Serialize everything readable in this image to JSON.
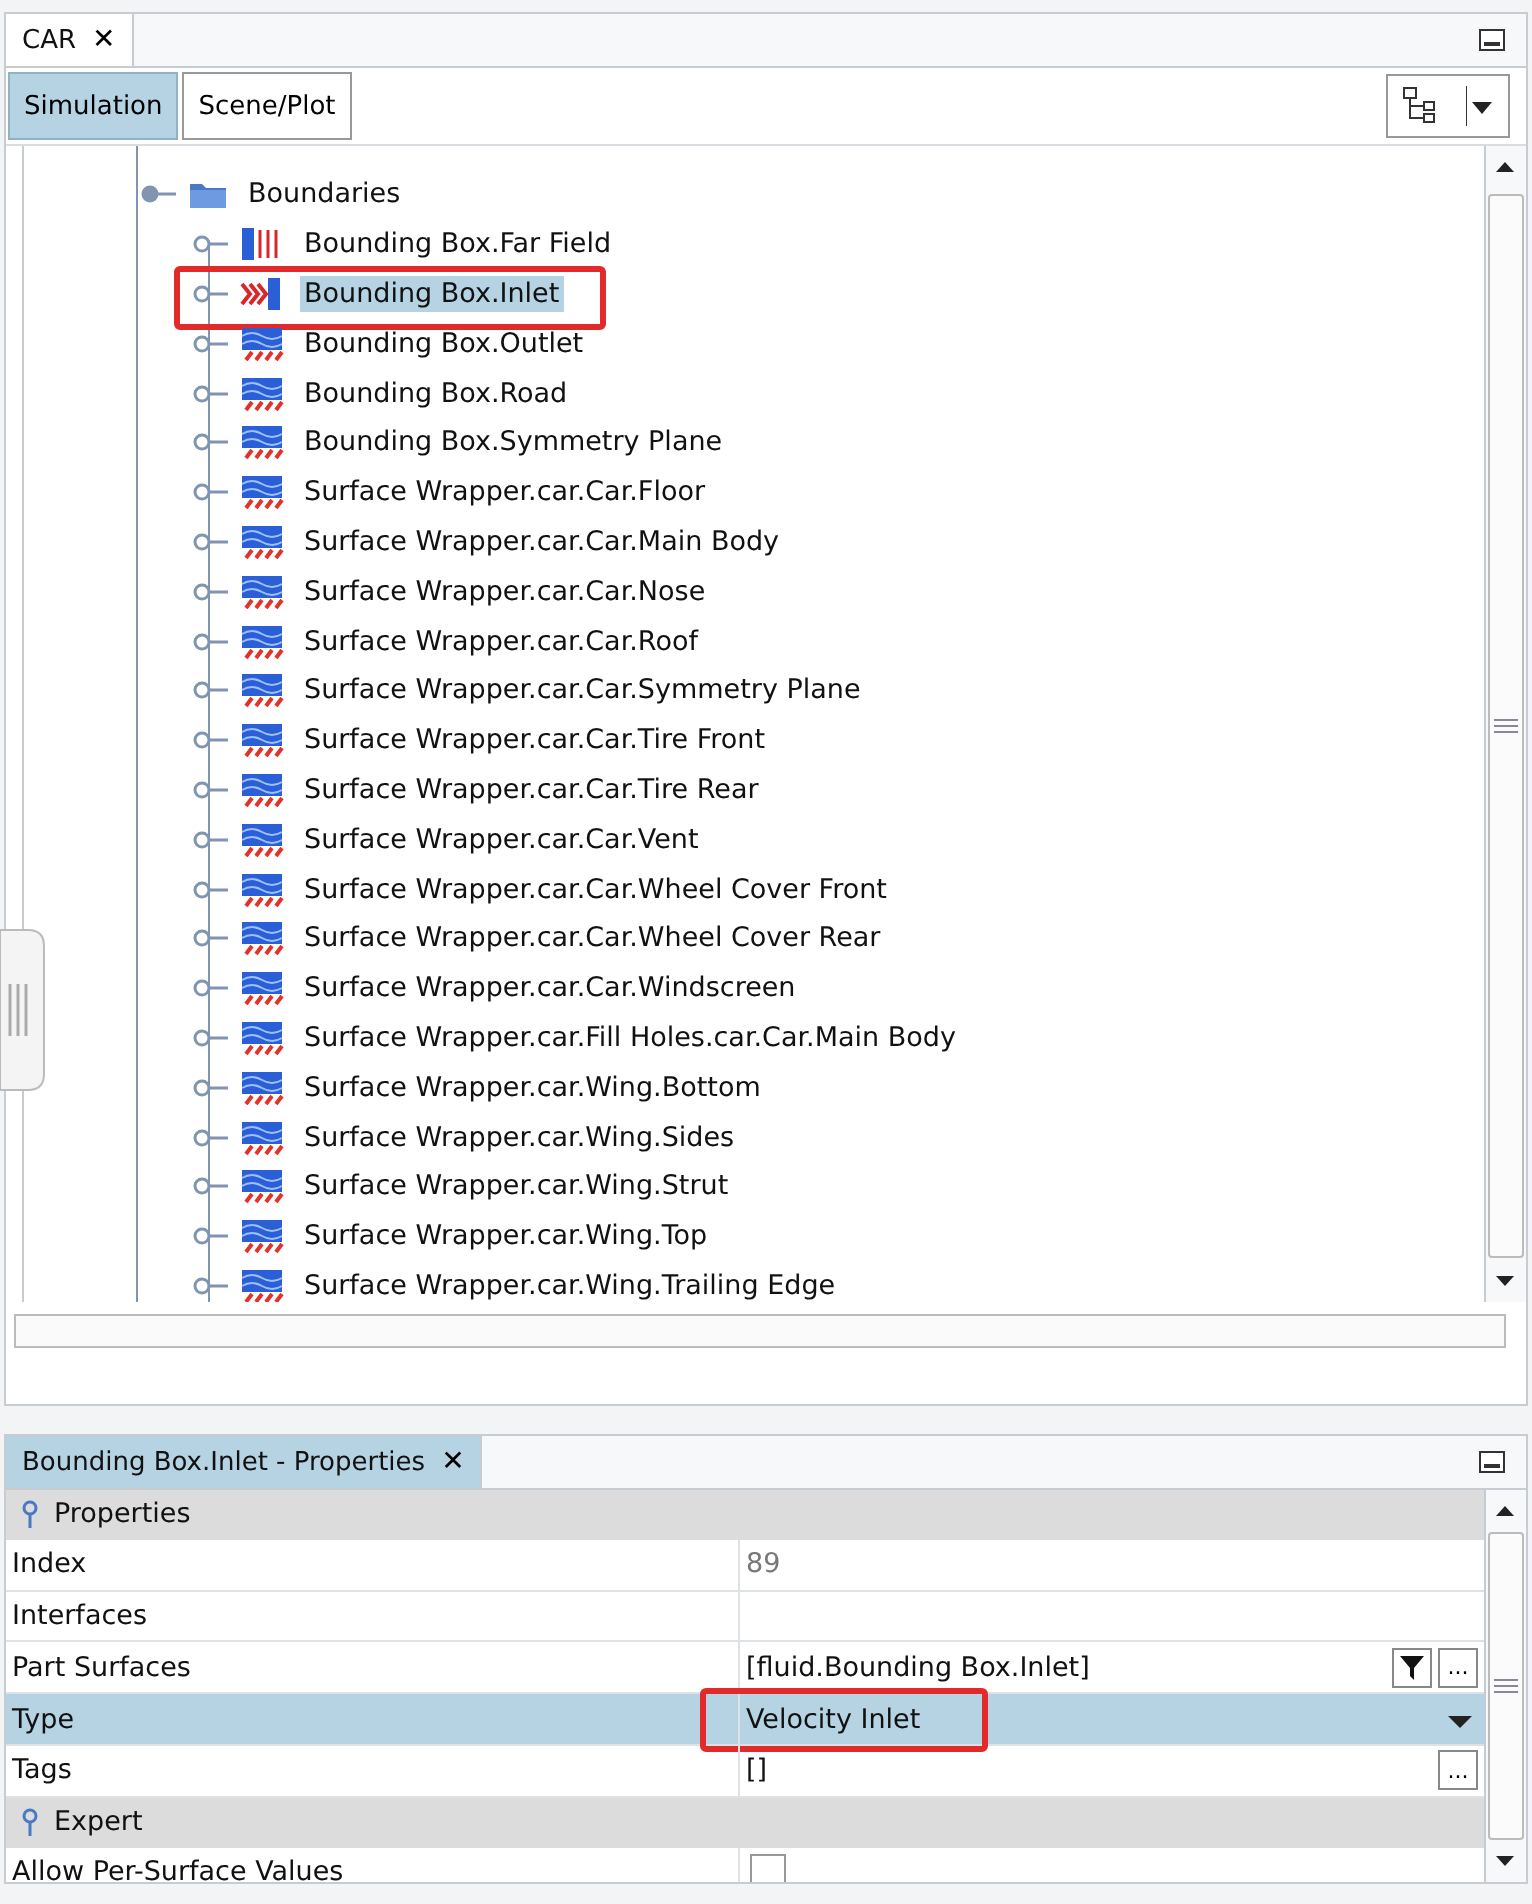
{
  "top_panel": {
    "tab": {
      "label": "CAR",
      "close": "✕"
    },
    "view_tabs": [
      {
        "label": "Simulation",
        "selected": true
      },
      {
        "label": "Scene/Plot",
        "selected": false
      }
    ]
  },
  "tree": {
    "label": "Boundaries",
    "kind": "folder",
    "expanded": true,
    "children": [
      {
        "label": "Bounding Box.Far Field",
        "kind": "free-stream",
        "selected": false,
        "highlighted": false
      },
      {
        "label": "Bounding Box.Inlet",
        "kind": "inlet",
        "selected": true,
        "highlighted": true
      },
      {
        "label": "Bounding Box.Outlet",
        "kind": "wall",
        "selected": false,
        "highlighted": false
      },
      {
        "label": "Bounding Box.Road",
        "kind": "wall",
        "selected": false,
        "highlighted": false
      },
      {
        "label": "Bounding Box.Symmetry Plane",
        "kind": "wall",
        "selected": false,
        "highlighted": false
      },
      {
        "label": "Surface Wrapper.car.Car.Floor",
        "kind": "wall",
        "selected": false,
        "highlighted": false
      },
      {
        "label": "Surface Wrapper.car.Car.Main Body",
        "kind": "wall",
        "selected": false,
        "highlighted": false
      },
      {
        "label": "Surface Wrapper.car.Car.Nose",
        "kind": "wall",
        "selected": false,
        "highlighted": false
      },
      {
        "label": "Surface Wrapper.car.Car.Roof",
        "kind": "wall",
        "selected": false,
        "highlighted": false
      },
      {
        "label": "Surface Wrapper.car.Car.Symmetry Plane",
        "kind": "wall",
        "selected": false,
        "highlighted": false
      },
      {
        "label": "Surface Wrapper.car.Car.Tire Front",
        "kind": "wall",
        "selected": false,
        "highlighted": false
      },
      {
        "label": "Surface Wrapper.car.Car.Tire Rear",
        "kind": "wall",
        "selected": false,
        "highlighted": false
      },
      {
        "label": "Surface Wrapper.car.Car.Vent",
        "kind": "wall",
        "selected": false,
        "highlighted": false
      },
      {
        "label": "Surface Wrapper.car.Car.Wheel Cover Front",
        "kind": "wall",
        "selected": false,
        "highlighted": false
      },
      {
        "label": "Surface Wrapper.car.Car.Wheel Cover Rear",
        "kind": "wall",
        "selected": false,
        "highlighted": false
      },
      {
        "label": "Surface Wrapper.car.Car.Windscreen",
        "kind": "wall",
        "selected": false,
        "highlighted": false
      },
      {
        "label": "Surface Wrapper.car.Fill Holes.car.Car.Main Body",
        "kind": "wall",
        "selected": false,
        "highlighted": false
      },
      {
        "label": "Surface Wrapper.car.Wing.Bottom",
        "kind": "wall",
        "selected": false,
        "highlighted": false
      },
      {
        "label": "Surface Wrapper.car.Wing.Sides",
        "kind": "wall",
        "selected": false,
        "highlighted": false
      },
      {
        "label": "Surface Wrapper.car.Wing.Strut",
        "kind": "wall",
        "selected": false,
        "highlighted": false
      },
      {
        "label": "Surface Wrapper.car.Wing.Top",
        "kind": "wall",
        "selected": false,
        "highlighted": false
      },
      {
        "label": "Surface Wrapper.car.Wing.Trailing Edge",
        "kind": "wall",
        "selected": false,
        "highlighted": false
      }
    ]
  },
  "properties_panel": {
    "tab": {
      "label": "Bounding Box.Inlet - Properties",
      "close": "✕"
    },
    "rows": [
      {
        "kind": "group",
        "label": "Properties"
      },
      {
        "kind": "text",
        "label": "Index",
        "value": "89",
        "selected": false,
        "highlighted": false
      },
      {
        "kind": "text",
        "label": "Interfaces",
        "selected": false,
        "highlighted": false
      },
      {
        "kind": "filter",
        "label": "Part Surfaces",
        "value": "[fluid.Bounding Box.Inlet]",
        "button": "...",
        "selected": false,
        "highlighted": false
      },
      {
        "kind": "dropdown",
        "label": "Type",
        "value": "Velocity Inlet",
        "selected": true,
        "highlighted": true
      },
      {
        "kind": "text",
        "label": "Tags",
        "value": "[]",
        "button": "...",
        "selected": false,
        "highlighted": false
      },
      {
        "kind": "group",
        "label": "Expert"
      },
      {
        "kind": "checkbox",
        "label": "Allow Per-Surface Values",
        "checked": false,
        "selected": false,
        "highlighted": false
      }
    ]
  }
}
